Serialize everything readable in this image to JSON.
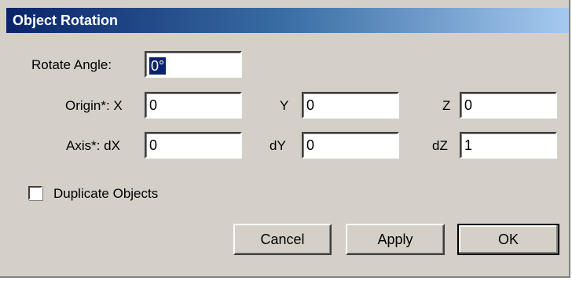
{
  "window": {
    "title": "Object Rotation"
  },
  "rotate": {
    "label": "Rotate Angle:",
    "value": "0°"
  },
  "origin": {
    "label": "Origin*: X",
    "x_value": "0",
    "y_label": "Y",
    "y_value": "0",
    "z_label": "Z",
    "z_value": "0"
  },
  "axis": {
    "label": "Axis*: dX",
    "dx_value": "0",
    "dy_label": "dY",
    "dy_value": "0",
    "dz_label": "dZ",
    "dz_value": "1"
  },
  "options": {
    "duplicate_label": "Duplicate Objects",
    "duplicate_checked": false
  },
  "buttons": {
    "cancel": "Cancel",
    "apply": "Apply",
    "ok": "OK"
  },
  "colors": {
    "titlebar_start": "#0a246a",
    "titlebar_end": "#a6caf0",
    "dialog_face": "#d4d0c8",
    "selection": "#0a246a"
  }
}
